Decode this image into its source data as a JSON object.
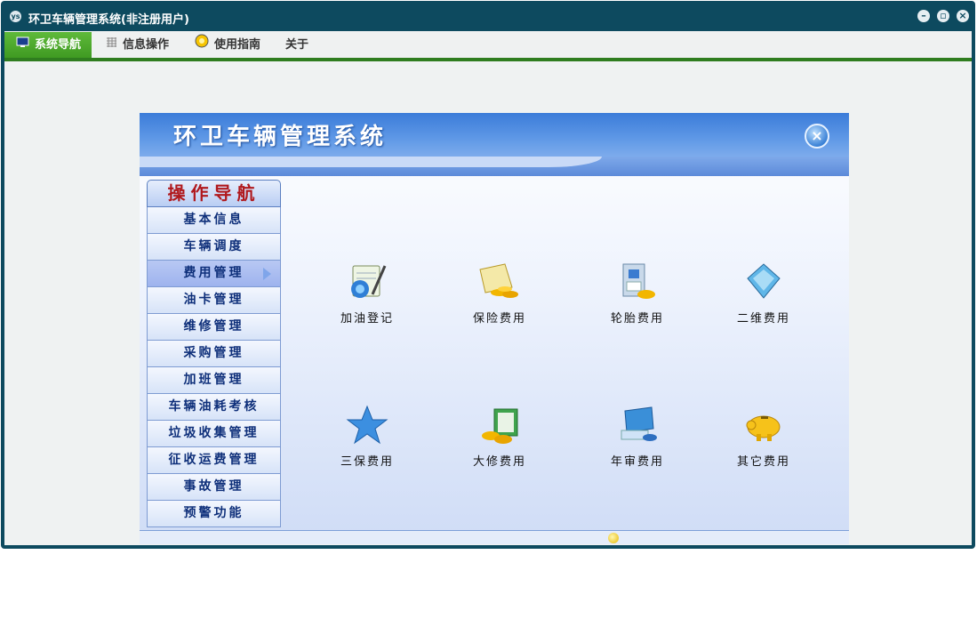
{
  "window": {
    "title": "环卫车辆管理系统(非注册用户)",
    "app_icon": "ys-logo-icon"
  },
  "menu": [
    {
      "label": "系统导航",
      "icon": "monitor-icon",
      "active": true
    },
    {
      "label": "信息操作",
      "icon": "grid-icon",
      "active": false
    },
    {
      "label": "使用指南",
      "icon": "lightbulb-icon",
      "active": false
    },
    {
      "label": "关于",
      "icon": "",
      "active": false
    }
  ],
  "panel": {
    "title": "环卫车辆管理系统",
    "close_icon": "close-circle-icon"
  },
  "nav": {
    "heading": "操作导航",
    "items": [
      "基本信息",
      "车辆调度",
      "费用管理",
      "油卡管理",
      "维修管理",
      "采购管理",
      "加班管理",
      "车辆油耗考核",
      "垃圾收集管理",
      "征收运费管理",
      "事故管理",
      "预警功能"
    ],
    "selected_index": 2
  },
  "functions": [
    {
      "label": "加油登记",
      "icon": "fuel-register-icon"
    },
    {
      "label": "保险费用",
      "icon": "insurance-gold-icon"
    },
    {
      "label": "轮胎费用",
      "icon": "tire-cost-icon"
    },
    {
      "label": "二维费用",
      "icon": "maintenance-book-icon"
    },
    {
      "label": "三保费用",
      "icon": "star-icon"
    },
    {
      "label": "大修费用",
      "icon": "money-coins-icon"
    },
    {
      "label": "年审费用",
      "icon": "annual-review-icon"
    },
    {
      "label": "其它费用",
      "icon": "piggy-bank-icon"
    }
  ],
  "colors": {
    "title_bar": "#0d4a5f",
    "menu_active": "#4fae2c",
    "nav_heading_text": "#b0181c",
    "nav_text": "#0e2f7a",
    "header_blue": "#3b7cd9"
  }
}
